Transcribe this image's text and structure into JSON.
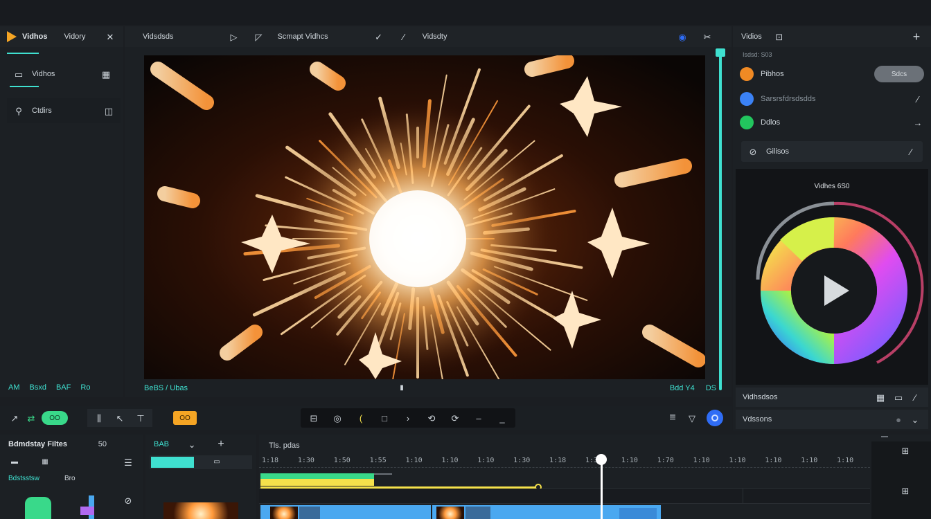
{
  "app": {
    "brand": "Vidhos",
    "menu_history": "Vidory"
  },
  "media_panel": {
    "items": [
      {
        "label": "Vidhos"
      },
      {
        "label": "Ctdirs"
      }
    ]
  },
  "preview_toolbar": {
    "label_left": "Vidsdsds",
    "label_mid": "Scmapt Vidhcs",
    "label_right": "Vidsdty"
  },
  "preview_bottom": {
    "left_labels": [
      "AM",
      "Bsxd",
      "BAF",
      "Ro"
    ],
    "center_label": "BeBS / Ubas",
    "right_label": "Bdd Y4",
    "far_right_label": "DS"
  },
  "right_panel": {
    "title": "Vidios",
    "subtitle": "Isdsd: S03",
    "rows": [
      {
        "label": "Pibhos",
        "dot": "#f08a24",
        "action": "Sdcs"
      },
      {
        "label": "Sarsrsfdrsdsdds",
        "dot": "#3b82f6"
      },
      {
        "label": "Ddlos",
        "dot": "#22c55e"
      }
    ],
    "search_label": "Gilisos",
    "wheel_title": "Vidhes 6S0",
    "footer_row1": "Vidhsdsos",
    "footer_row2": "Vdssons"
  },
  "controls": {
    "pill_label": "OO",
    "badge_label": "OO"
  },
  "bottom_left": {
    "title": "Bdmdstay Filtes",
    "title_code": "50",
    "sublabel": "Bdstsstsw",
    "sublabel2": "Bro"
  },
  "bottom_mid": {
    "tab_label": "BAB"
  },
  "timeline": {
    "title": "Tls. pdas",
    "ticks": [
      "1:18",
      "1:30",
      "1:50",
      "1:55",
      "1:10",
      "1:10",
      "1:10",
      "1:30",
      "1:18",
      "1:30",
      "1:10",
      "1:70",
      "1:10",
      "1:10",
      "1:10",
      "1:10",
      "1:10"
    ],
    "playhead_fraction": 0.56
  },
  "colors": {
    "accent_teal": "#3fe0d0",
    "accent_green": "#39d98a",
    "accent_orange": "#f5a524",
    "accent_blue": "#2f6df6",
    "clip_blue": "#4aa8f0",
    "clip_yellow": "#f5e14b"
  }
}
